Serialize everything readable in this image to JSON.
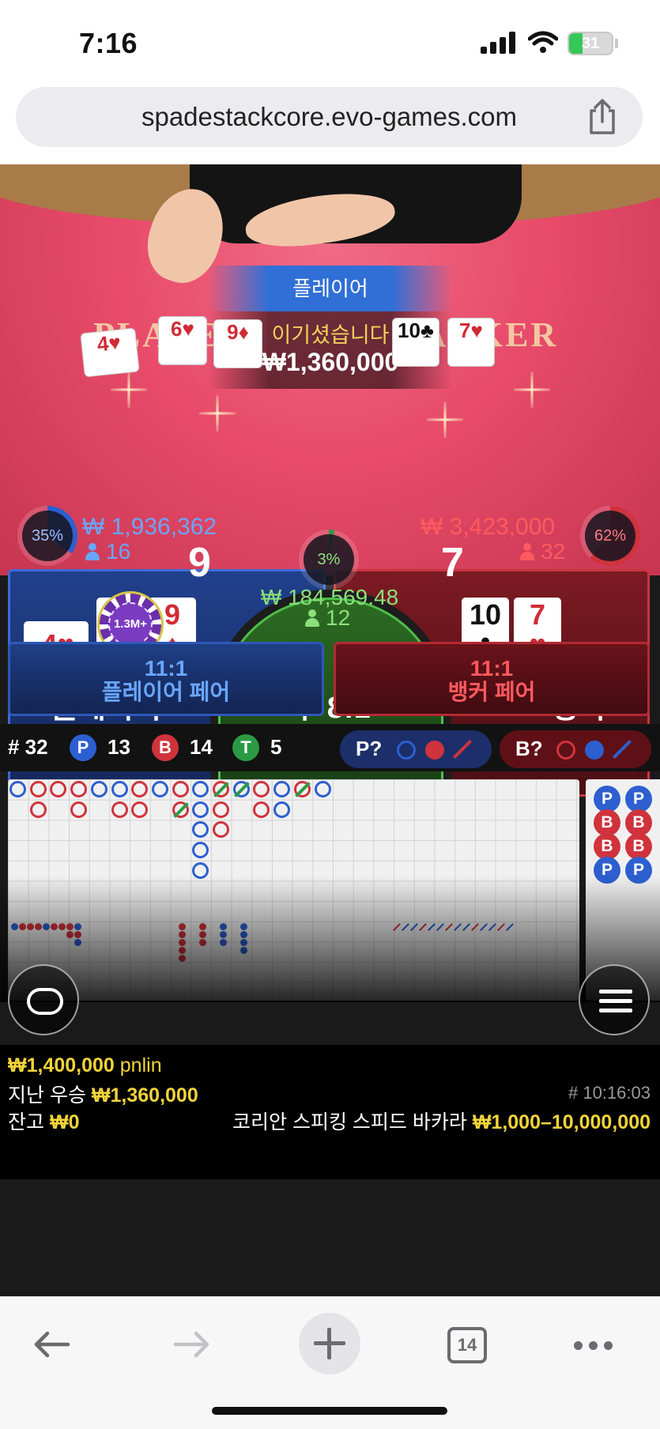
{
  "status_bar": {
    "time": "7:16",
    "battery": "31",
    "battery_level": 0.31
  },
  "browser": {
    "url": "spadestackcore.evo-games.com",
    "tab_count": "14"
  },
  "table": {
    "felt_player": "PLAYER",
    "felt_banker": "BANKER",
    "win_banner": "플레이어",
    "win_message": "이기셨습니다",
    "win_amount": "₩1,360,000",
    "felt_cards": [
      {
        "rank": "4",
        "suit": "♥",
        "color": "red"
      },
      {
        "rank": "6",
        "suit": "♥",
        "color": "red"
      },
      {
        "rank": "9",
        "suit": "♦",
        "color": "red"
      },
      {
        "rank": "10",
        "suit": "♣",
        "color": "black"
      },
      {
        "rank": "7",
        "suit": "♥",
        "color": "red"
      }
    ]
  },
  "player": {
    "percent": "35%",
    "percent_value": 35,
    "amount": "₩ 1,936,362",
    "bettors": "16",
    "score": "9",
    "label": "플레이어",
    "cards": [
      {
        "rank": "4",
        "suit": "♥",
        "color": "red"
      },
      {
        "rank": "6",
        "suit": "♥",
        "color": "red"
      },
      {
        "rank": "9",
        "suit": "♦",
        "color": "red"
      }
    ],
    "chip": "1.3M+"
  },
  "tie": {
    "percent": "3%",
    "percent_value": 3,
    "amount": "₩ 184,569.48",
    "bettors": "12",
    "label": "무 8:1"
  },
  "banker": {
    "percent": "62%",
    "percent_value": 62,
    "amount": "₩ 3,423,000",
    "bettors": "32",
    "score": "7",
    "label": "뱅커",
    "cards": [
      {
        "rank": "10",
        "suit": "♣",
        "color": "black"
      },
      {
        "rank": "7",
        "suit": "♥",
        "color": "red"
      }
    ]
  },
  "pairs": {
    "player": {
      "odds": "11:1",
      "label": "플레이어 페어"
    },
    "banker": {
      "odds": "11:1",
      "label": "뱅커 페어"
    }
  },
  "stats": {
    "rounds_label": "# 32",
    "player_badge": "P",
    "player_count": "13",
    "banker_badge": "B",
    "banker_count": "14",
    "tie_badge": "T",
    "tie_count": "5",
    "predict_player": "P?",
    "predict_banker": "B?"
  },
  "side_road": [
    "P",
    "B",
    "B",
    "P"
  ],
  "info": {
    "bet_line_amount": "₩1,400,000",
    "bet_line_user": "pnlin",
    "last_win_label": "지난 우승",
    "last_win_amount": "₩1,360,000",
    "round_id": "# 10:16:03",
    "balance_label": "잔고",
    "balance_amount": "₩0",
    "game_name": "코리안 스피킹 스피드 바카라",
    "limits": "₩1,000–10,000,000"
  },
  "colors": {
    "player": "#2d5fd0",
    "banker": "#d0333c",
    "tie": "#2b9a44",
    "gold": "#f2d43a",
    "felt": "#e84c6a"
  }
}
